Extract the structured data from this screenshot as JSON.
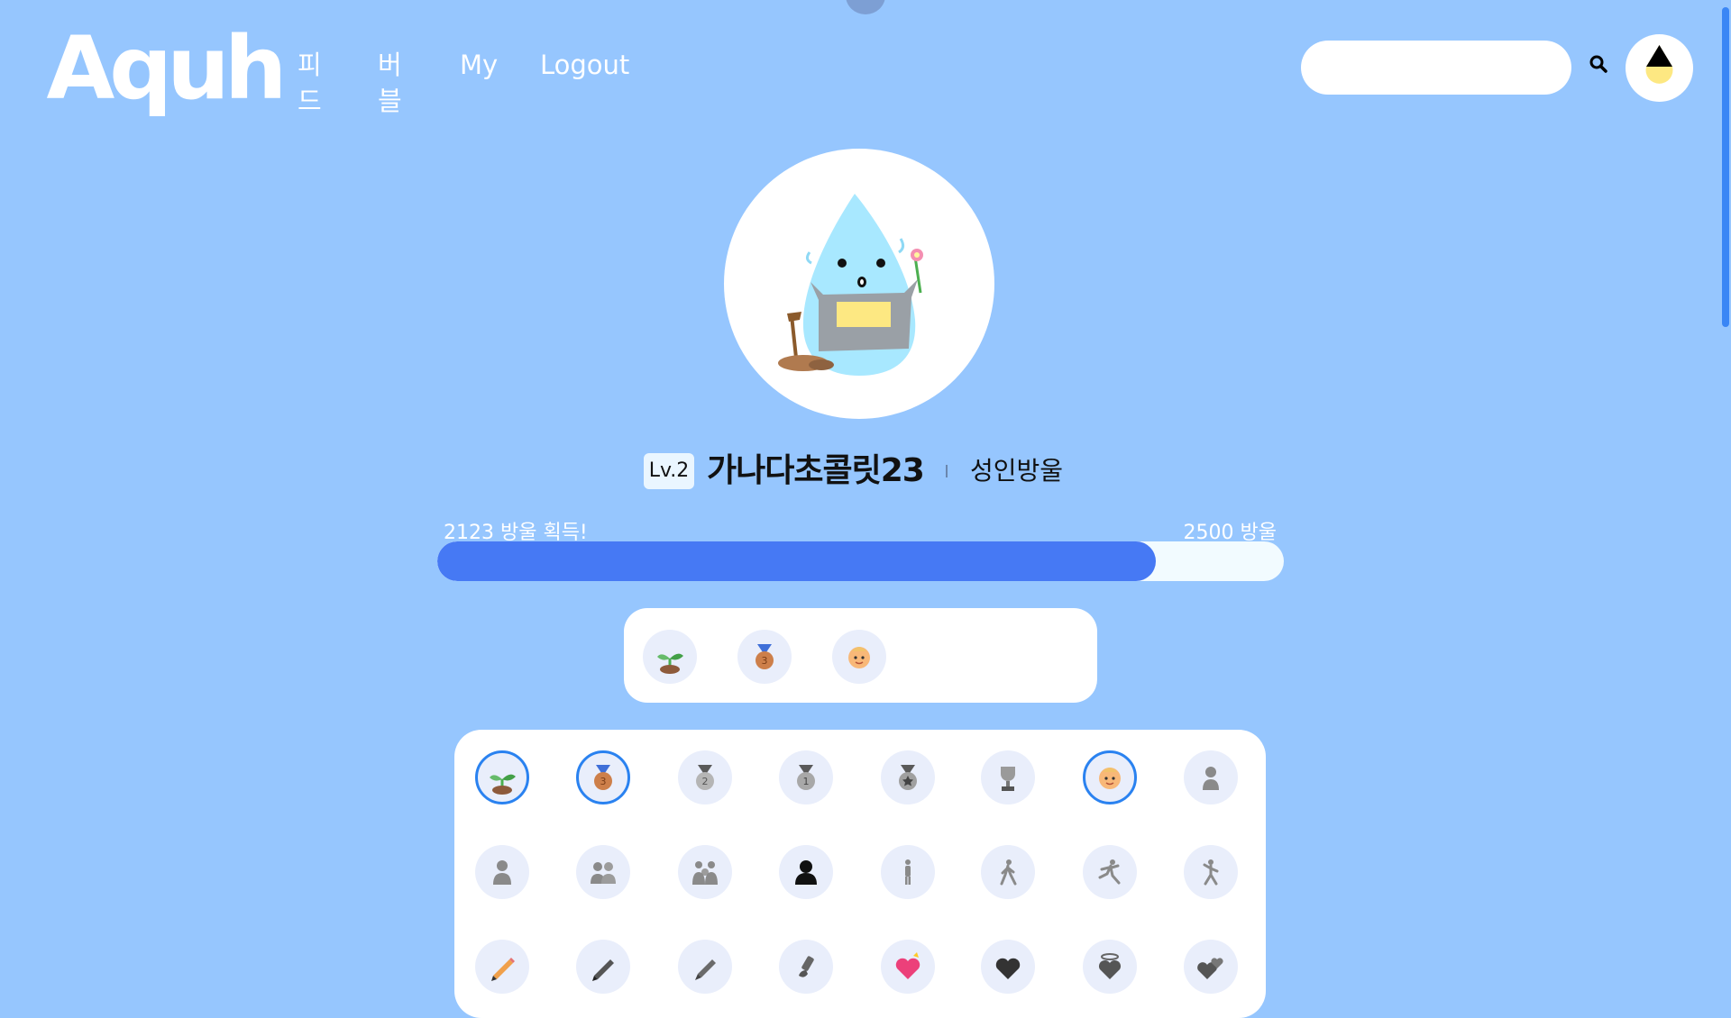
{
  "header": {
    "logo_text": "Aquh",
    "nav": [
      {
        "label": "피드"
      },
      {
        "label": "버블"
      },
      {
        "label": "My"
      },
      {
        "label": "Logout"
      }
    ],
    "search": {
      "placeholder": "",
      "value": ""
    }
  },
  "profile": {
    "level": "Lv.2",
    "nickname": "가나다초콜릿23",
    "rank_title": "성인방울"
  },
  "progress": {
    "current_label": "2123 방울 획득!",
    "max_label": "2500 방울",
    "current": 2123,
    "max": 2500
  },
  "selected_badges": [
    "seedling-badge-icon",
    "bronze-medal-badge-icon",
    "baby-badge-icon"
  ],
  "badges": [
    {
      "icon": "seedling-badge-icon",
      "active": true
    },
    {
      "icon": "bronze-medal-badge-icon",
      "active": true
    },
    {
      "icon": "silver-medal-badge-icon",
      "active": false
    },
    {
      "icon": "gold-medal-badge-icon",
      "active": false
    },
    {
      "icon": "star-medal-badge-icon",
      "active": false
    },
    {
      "icon": "trophy-badge-icon",
      "active": false
    },
    {
      "icon": "baby-badge-icon",
      "active": true
    },
    {
      "icon": "child-badge-icon",
      "active": false
    },
    {
      "icon": "person-badge-icon",
      "active": false
    },
    {
      "icon": "two-people-badge-icon",
      "active": false
    },
    {
      "icon": "family-badge-icon",
      "active": false
    },
    {
      "icon": "silhouette-badge-icon",
      "active": false
    },
    {
      "icon": "standing-person-badge-icon",
      "active": false
    },
    {
      "icon": "walking-person-badge-icon",
      "active": false
    },
    {
      "icon": "running-person-badge-icon",
      "active": false
    },
    {
      "icon": "climbing-person-badge-icon",
      "active": false
    },
    {
      "icon": "pencil-badge-icon",
      "active": false
    },
    {
      "icon": "pen-badge-icon",
      "active": false
    },
    {
      "icon": "fountain-pen-badge-icon",
      "active": false
    },
    {
      "icon": "brush-badge-icon",
      "active": false
    },
    {
      "icon": "heart-ribbon-badge-icon",
      "active": false
    },
    {
      "icon": "black-heart-badge-icon",
      "active": false
    },
    {
      "icon": "heart-halo-badge-icon",
      "active": false
    },
    {
      "icon": "two-hearts-badge-icon",
      "active": false
    }
  ],
  "colors": {
    "background": "#96c6fe",
    "progress_fill": "#4679f4",
    "active_ring": "#2a82f0"
  }
}
